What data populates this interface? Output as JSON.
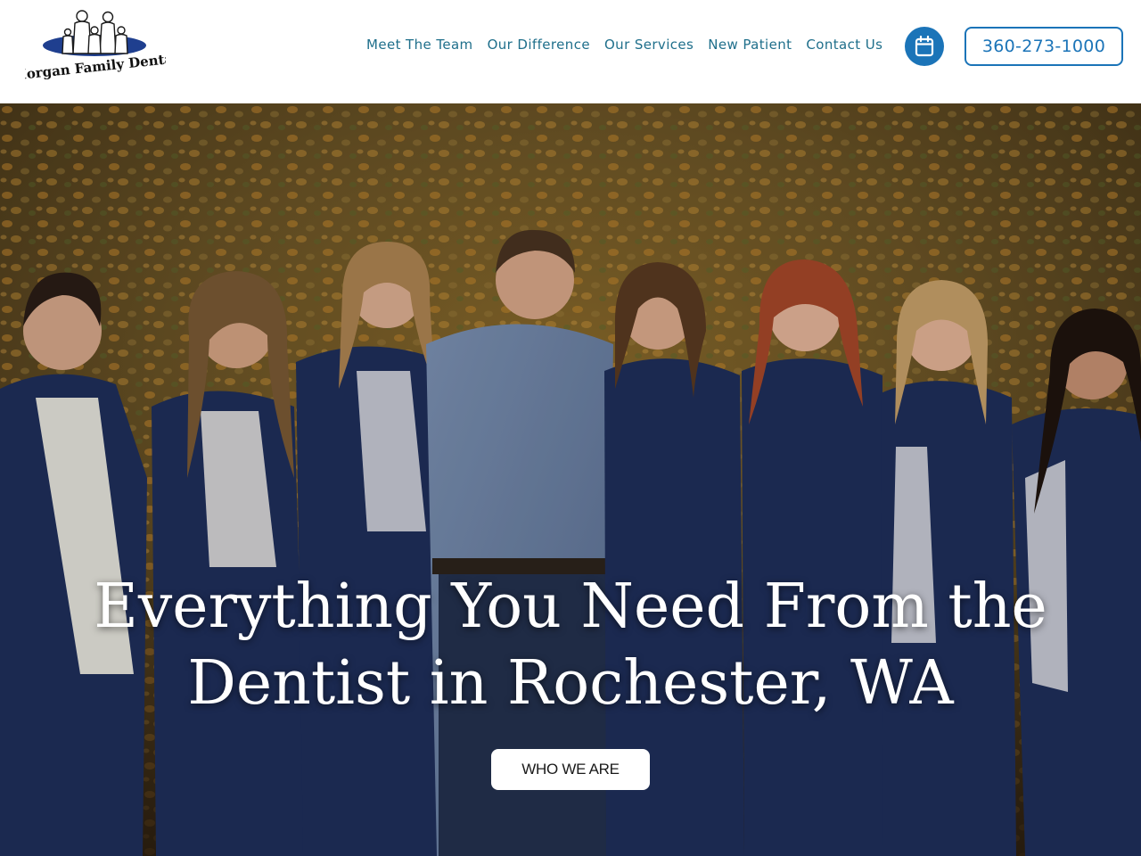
{
  "brand": {
    "name": "Morgan Family Dental",
    "colors": {
      "nav_text": "#1f6f8b",
      "accent_blue": "#1b74b8",
      "logo_navy": "#1f3f8f",
      "white": "#ffffff"
    }
  },
  "nav": {
    "items": [
      {
        "label": "Meet The Team"
      },
      {
        "label": "Our Difference"
      },
      {
        "label": "Our Services"
      },
      {
        "label": "New Patient"
      },
      {
        "label": "Contact Us"
      }
    ],
    "calendar_icon": "calendar-icon",
    "phone": "360-273-1000"
  },
  "hero": {
    "title_line1": "Everything You Need From the",
    "title_line2": "Dentist in Rochester, WA",
    "button_label": "WHO WE ARE"
  }
}
